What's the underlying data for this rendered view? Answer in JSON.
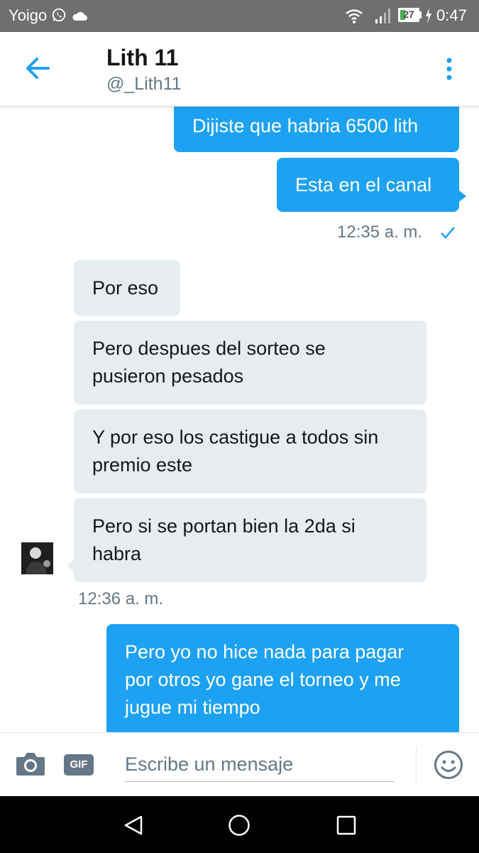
{
  "status_bar": {
    "carrier": "Yoigo",
    "battery": "27",
    "battery_level": 0.27,
    "time": "0:47",
    "icons": [
      "whatsapp-icon",
      "cloud-icon",
      "wifi-icon",
      "signal-icon",
      "battery-icon",
      "charging-icon"
    ]
  },
  "header": {
    "title": "Lith 11",
    "handle": "@_Lith11",
    "icons": [
      "back-arrow-icon",
      "more-vertical-icon"
    ]
  },
  "messages": [
    {
      "direction": "out",
      "text": "Dijiste que habria 6500 lith"
    },
    {
      "direction": "out",
      "text": "Esta en el canal"
    },
    {
      "direction": "in",
      "text": "Por eso"
    },
    {
      "direction": "in",
      "lines": [
        "Pero despues del sorteo se",
        "pusieron pesados"
      ]
    },
    {
      "direction": "in",
      "lines": [
        "Y por eso los castigue a todos sin",
        "premio este"
      ]
    },
    {
      "direction": "in",
      "lines": [
        "Pero si se portan bien la 2da si",
        "habra"
      ]
    },
    {
      "direction": "out",
      "lines": [
        "Pero yo no hice nada para pagar",
        "por otros yo gane el torneo y me",
        "jugue mi tiempo"
      ]
    }
  ],
  "timestamps": {
    "sent": "12:35 a. m.",
    "received": "12:36 a. m."
  },
  "composer": {
    "placeholder": "Escribe un mensaje",
    "gif_label": "GIF",
    "icons": [
      "camera-icon",
      "emoji-icon"
    ]
  },
  "navbar": {
    "icons": [
      "nav-back-icon",
      "nav-home-icon",
      "nav-recent-icon"
    ]
  },
  "colors": {
    "accent": "#1da1f2",
    "incoming_bubble": "#e6ecf0",
    "secondary_text": "#657786",
    "status_bar": "#6f6f6f"
  }
}
